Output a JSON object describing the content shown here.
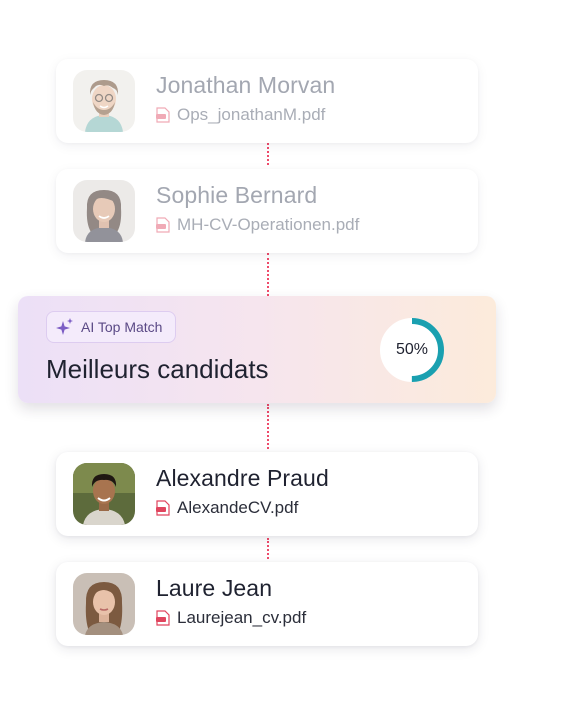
{
  "candidates_top": [
    {
      "name": "Jonathan Morvan",
      "file": "Ops_jonathanM.pdf"
    },
    {
      "name": "Sophie Bernard",
      "file": "MH-CV-Operationen.pdf"
    }
  ],
  "match": {
    "badge_label": "AI Top Match",
    "title": "Meilleurs candidats",
    "percent_label": "50%",
    "percent_value": 50,
    "ring_color": "#1aa0b0"
  },
  "candidates_bottom": [
    {
      "name": "Alexandre Praud",
      "file": "AlexandeCV.pdf"
    },
    {
      "name": "Laure Jean",
      "file": "Laurejean_cv.pdf"
    }
  ],
  "colors": {
    "connector": "#ef4b6b",
    "pdf_icon": "#e0455e",
    "sparkle": "#7b5cc4"
  }
}
